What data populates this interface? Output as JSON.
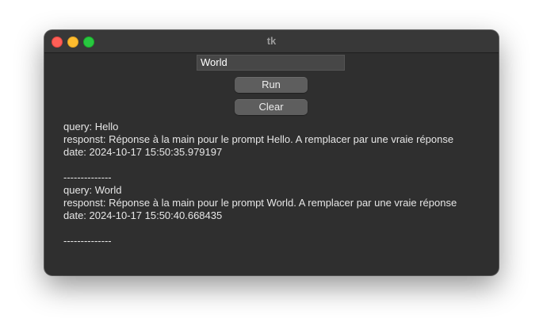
{
  "window": {
    "title": "tk",
    "controls": [
      "close",
      "minimize",
      "zoom"
    ]
  },
  "entry": {
    "value": "World"
  },
  "buttons": {
    "run_label": "Run",
    "clear_label": "Clear"
  },
  "output": {
    "lines": [
      "query: Hello",
      "responst: Réponse à la main pour le prompt Hello. A remplacer par une vraie réponse",
      "date: 2024-10-17 15:50:35.979197",
      "",
      "--------------",
      "query: World",
      "responst: Réponse à la main pour le prompt World. A remplacer par une vraie réponse",
      "date: 2024-10-17 15:50:40.668435",
      "",
      "--------------"
    ]
  }
}
